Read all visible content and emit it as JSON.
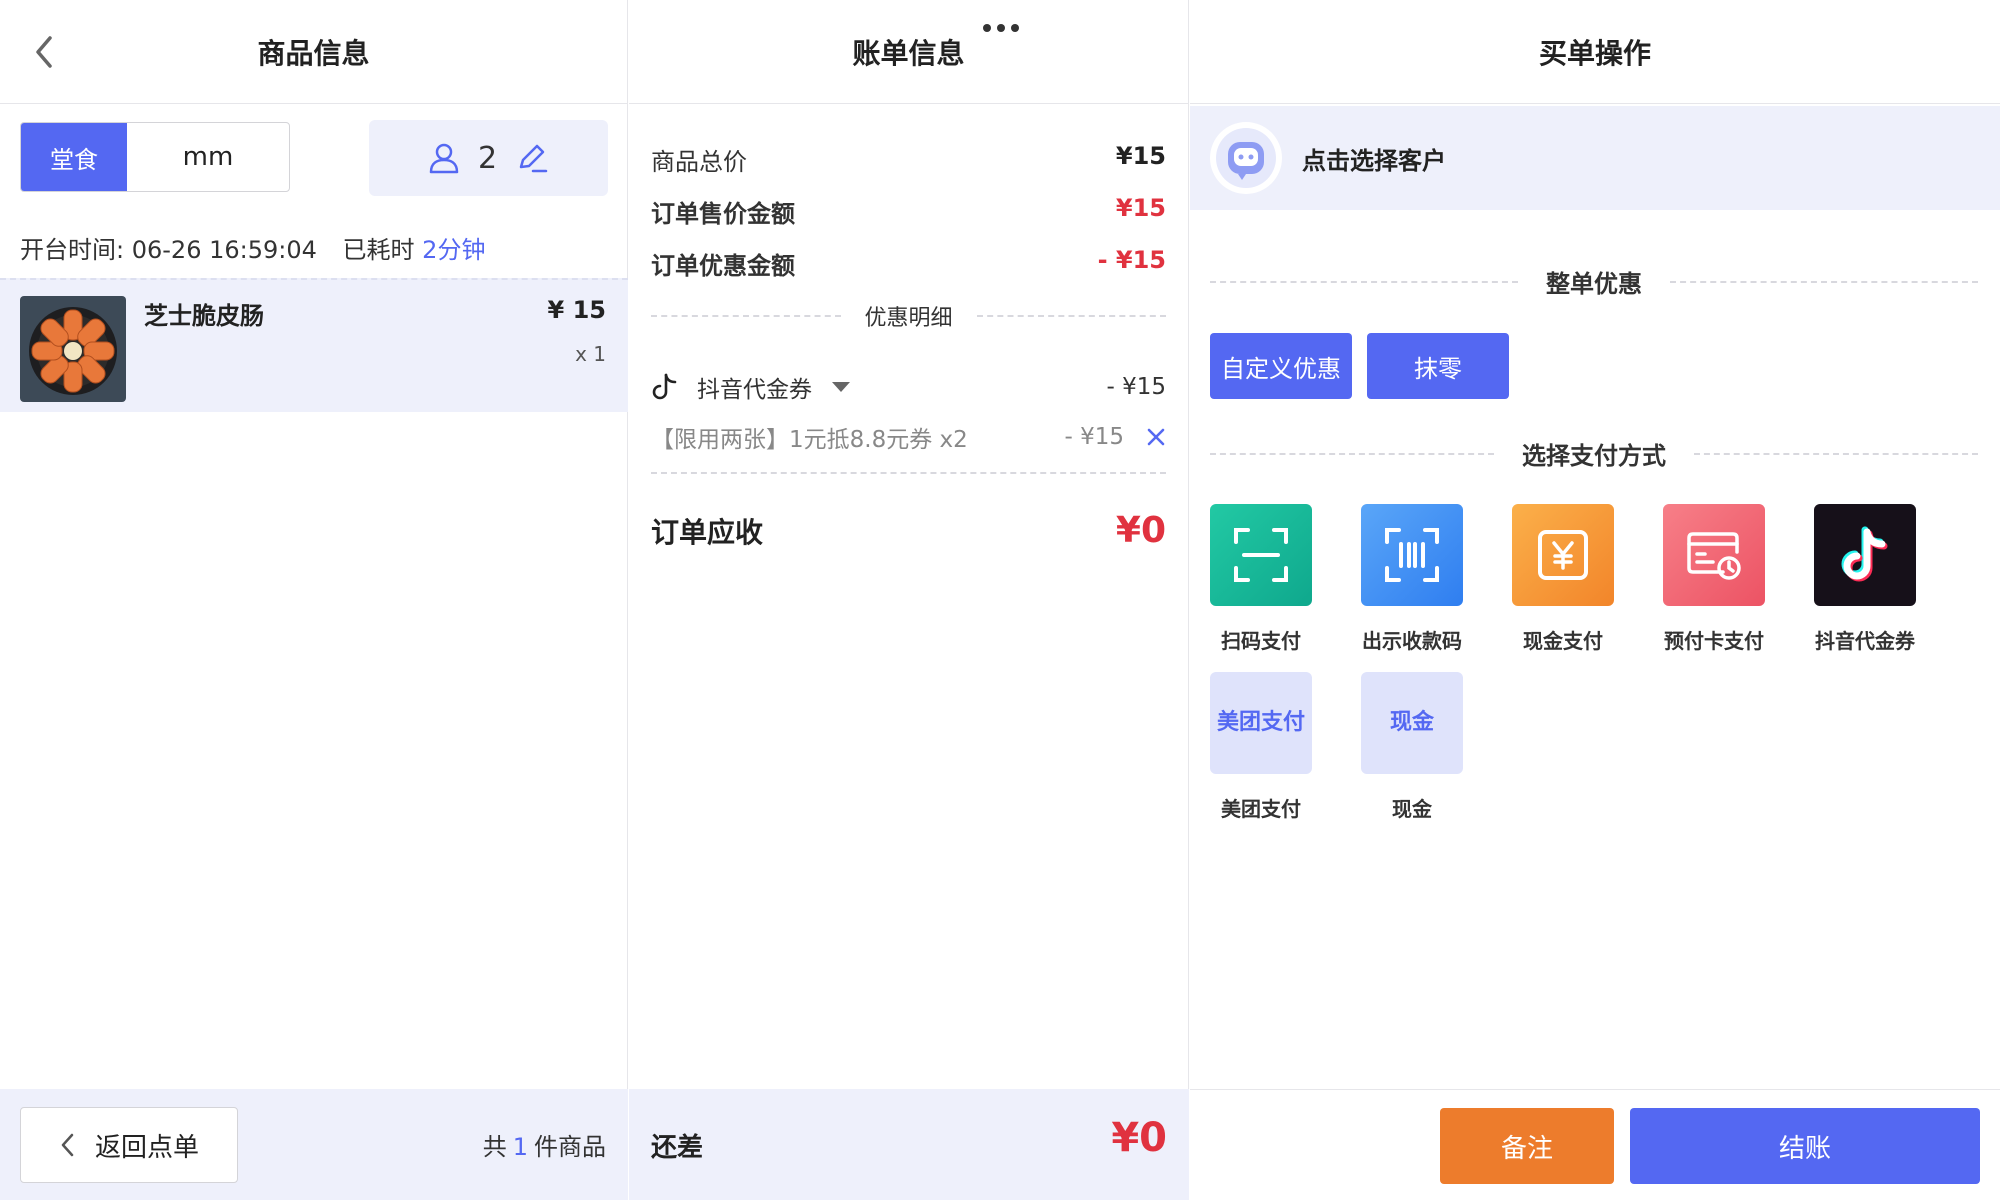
{
  "left": {
    "title": "商品信息",
    "dine_mode": "堂食",
    "order_name": "mm",
    "guest_count": "2",
    "open_time_label": "开台时间:",
    "open_time_value": "06-26 16:59:04",
    "elapsed_label": "已耗时",
    "elapsed_value": "2分钟",
    "items": [
      {
        "name": "芝士脆皮肠",
        "price": "¥ 15",
        "qty": "x 1"
      }
    ],
    "return_button": "返回点单",
    "total_prefix": "共",
    "total_count": "1",
    "total_suffix": "件商品"
  },
  "middle": {
    "title": "账单信息",
    "rows": [
      {
        "label": "商品总价",
        "value": "¥15"
      },
      {
        "label": "订单售价金额",
        "value": "¥15"
      },
      {
        "label": "订单优惠金额",
        "value": "- ¥15"
      }
    ],
    "discount_detail_title": "优惠明细",
    "coupon_name": "抖音代金券",
    "coupon_amount": "- ¥15",
    "coupon_detail_text": "【限用两张】1元抵8.8元券 x2",
    "coupon_detail_amount": "- ¥15",
    "receivable_label": "订单应收",
    "receivable_value": "¥0",
    "balance_label": "还差",
    "balance_value": "¥0"
  },
  "right": {
    "title": "买单操作",
    "customer_prompt": "点击选择客户",
    "whole_discount_title": "整单优惠",
    "discount_buttons": [
      "自定义优惠",
      "抹零"
    ],
    "payment_title": "选择支付方式",
    "payments": [
      {
        "label": "扫码支付",
        "icon": "scan-icon",
        "color": "#16b79b"
      },
      {
        "label": "出示收款码",
        "icon": "barcode-icon",
        "color": "#3f8ef5"
      },
      {
        "label": "现金支付",
        "icon": "cash-yen-icon",
        "color": "#f59a36"
      },
      {
        "label": "预付卡支付",
        "icon": "prepaid-card-icon",
        "color": "#f06470"
      },
      {
        "label": "抖音代金券",
        "icon": "tiktok-icon",
        "color": "#161019"
      },
      {
        "label": "美团支付",
        "tile_text": "美团支付"
      },
      {
        "label": "现金",
        "tile_text": "现金"
      }
    ],
    "note_button": "备注",
    "checkout_button": "结账"
  },
  "colors": {
    "accent": "#5468f2",
    "danger": "#e0323f",
    "orange": "#ed7c2c",
    "panel_bg": "#eef0fb"
  }
}
